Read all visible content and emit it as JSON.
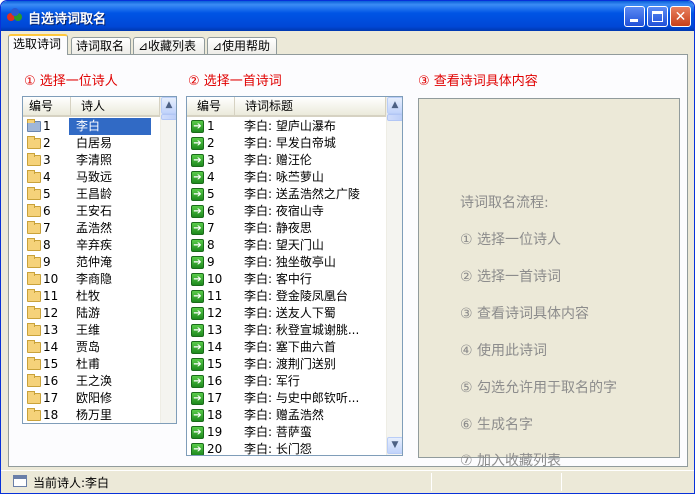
{
  "window": {
    "title": "自选诗词取名"
  },
  "tabs": [
    {
      "label": "选取诗词"
    },
    {
      "label": "诗词取名"
    },
    {
      "label": "⊿收藏列表"
    },
    {
      "label": "⊿使用帮助"
    }
  ],
  "steps": {
    "s1": "① 选择一位诗人",
    "s2": "② 选择一首诗词",
    "s3": "③ 查看诗词具体内容"
  },
  "poets": {
    "col_id": "编号",
    "col_name": "诗人",
    "rows": [
      {
        "id": "1",
        "name": "李白"
      },
      {
        "id": "2",
        "name": "白居易"
      },
      {
        "id": "3",
        "name": "李清照"
      },
      {
        "id": "4",
        "name": "马致远"
      },
      {
        "id": "5",
        "name": "王昌龄"
      },
      {
        "id": "6",
        "name": "王安石"
      },
      {
        "id": "7",
        "name": "孟浩然"
      },
      {
        "id": "8",
        "name": "辛弃疾"
      },
      {
        "id": "9",
        "name": "范仲淹"
      },
      {
        "id": "10",
        "name": "李商隐"
      },
      {
        "id": "11",
        "name": "杜牧"
      },
      {
        "id": "12",
        "name": "陆游"
      },
      {
        "id": "13",
        "name": "王维"
      },
      {
        "id": "14",
        "name": "贾岛"
      },
      {
        "id": "15",
        "name": "杜甫"
      },
      {
        "id": "16",
        "name": "王之涣"
      },
      {
        "id": "17",
        "name": "欧阳修"
      },
      {
        "id": "18",
        "name": "杨万里"
      }
    ]
  },
  "poems": {
    "col_id": "编号",
    "col_title": "诗词标题",
    "rows": [
      {
        "id": "1",
        "title": "李白: 望庐山瀑布"
      },
      {
        "id": "2",
        "title": "李白: 早发白帝城"
      },
      {
        "id": "3",
        "title": "李白: 赠汪伦"
      },
      {
        "id": "4",
        "title": "李白: 咏苎萝山"
      },
      {
        "id": "5",
        "title": "李白: 送孟浩然之广陵"
      },
      {
        "id": "6",
        "title": "李白: 夜宿山寺"
      },
      {
        "id": "7",
        "title": "李白: 静夜思"
      },
      {
        "id": "8",
        "title": "李白: 望天门山"
      },
      {
        "id": "9",
        "title": "李白: 独坐敬亭山"
      },
      {
        "id": "10",
        "title": "李白: 客中行"
      },
      {
        "id": "11",
        "title": "李白: 登金陵凤凰台"
      },
      {
        "id": "12",
        "title": "李白: 送友人下蜀"
      },
      {
        "id": "13",
        "title": "李白: 秋登宣城谢朓..."
      },
      {
        "id": "14",
        "title": "李白: 塞下曲六首"
      },
      {
        "id": "15",
        "title": "李白: 渡荆门送别"
      },
      {
        "id": "16",
        "title": "李白: 军行"
      },
      {
        "id": "17",
        "title": "李白: 与史中郎钦听..."
      },
      {
        "id": "18",
        "title": "李白: 赠孟浩然"
      },
      {
        "id": "19",
        "title": "李白: 菩萨蛮"
      },
      {
        "id": "20",
        "title": "李白: 长门怨"
      }
    ]
  },
  "process": {
    "title": "诗词取名流程:",
    "items": [
      "① 选择一位诗人",
      "② 选择一首诗词",
      "③ 查看诗词具体内容",
      "④ 使用此诗词",
      "⑤ 勾选允许用于取名的字",
      "⑥ 生成名字",
      "⑦ 加入收藏列表"
    ]
  },
  "status": {
    "text": "当前诗人:李白"
  },
  "colors": {
    "step_text": "#E00000",
    "selection": "#316AC5",
    "titlebar": "#0055E5"
  }
}
